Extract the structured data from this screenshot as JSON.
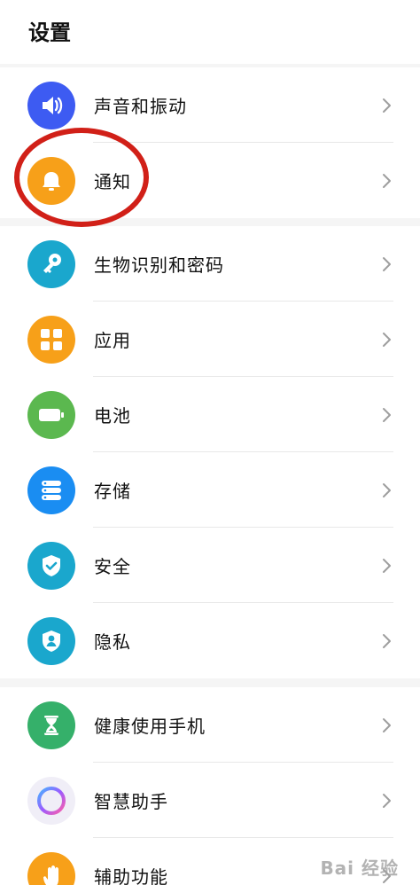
{
  "header": {
    "title": "设置"
  },
  "groups": [
    {
      "items": [
        {
          "label": "声音和振动",
          "color": "#3d5bf2",
          "icon": "volume-icon"
        },
        {
          "label": "通知",
          "color": "#f7a019",
          "icon": "bell-icon"
        }
      ]
    },
    {
      "items": [
        {
          "label": "生物识别和密码",
          "color": "#1aa7cd",
          "icon": "key-icon"
        },
        {
          "label": "应用",
          "color": "#f7a019",
          "icon": "apps-grid-icon"
        },
        {
          "label": "电池",
          "color": "#5bb84f",
          "icon": "battery-icon"
        },
        {
          "label": "存储",
          "color": "#1a8df2",
          "icon": "storage-icon"
        },
        {
          "label": "安全",
          "color": "#1aa7cd",
          "icon": "shield-check-icon"
        },
        {
          "label": "隐私",
          "color": "#1aa7cd",
          "icon": "privacy-shield-icon"
        }
      ]
    },
    {
      "items": [
        {
          "label": "健康使用手机",
          "color": "#35b06a",
          "icon": "hourglass-icon"
        },
        {
          "label": "智慧助手",
          "color": "#f0eef7",
          "icon": "assistant-ring-icon"
        },
        {
          "label": "辅助功能",
          "color": "#f7a019",
          "icon": "hand-icon"
        }
      ]
    }
  ],
  "annotation": {
    "color": "#d12018"
  },
  "watermark": {
    "text": "Bai 经验"
  }
}
